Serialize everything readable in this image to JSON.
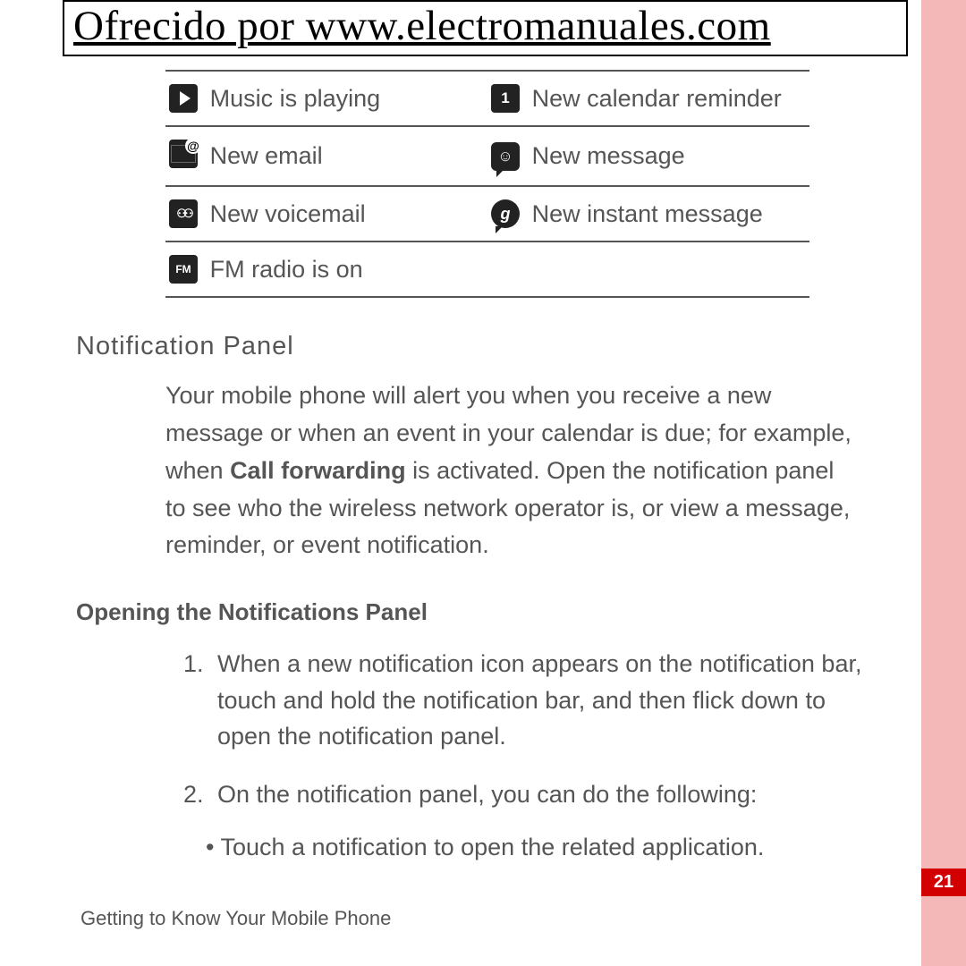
{
  "header": {
    "attribution": "Ofrecido por www.electromanuales.com"
  },
  "icon_table": {
    "rows": [
      {
        "left_label": "Music is playing",
        "right_label": "New calendar reminder"
      },
      {
        "left_label": "New email",
        "right_label": "New message"
      },
      {
        "left_label": "New voicemail",
        "right_label": "New instant message"
      },
      {
        "left_label": "FM radio is on",
        "right_label": ""
      }
    ]
  },
  "sections": {
    "title1": "Notification Panel",
    "body1_pre": "Your mobile phone will alert you when you receive a new message or when an event in your calendar is due; for example, when ",
    "body1_bold": "Call forwarding",
    "body1_post": " is activated. Open the notification panel to see who the wireless network operator is, or view a message, reminder, or event notification.",
    "title2": "Opening the Notifications Panel",
    "step1": "When a new notification icon appears on the notification bar, touch and hold the notification bar, and then flick down to open the notification panel.",
    "step2": "On the notification panel, you can do the following:",
    "bullet1": "Touch a notification to open the related application."
  },
  "footer": {
    "chapter": "Getting to Know Your Mobile Phone",
    "page": "21"
  }
}
